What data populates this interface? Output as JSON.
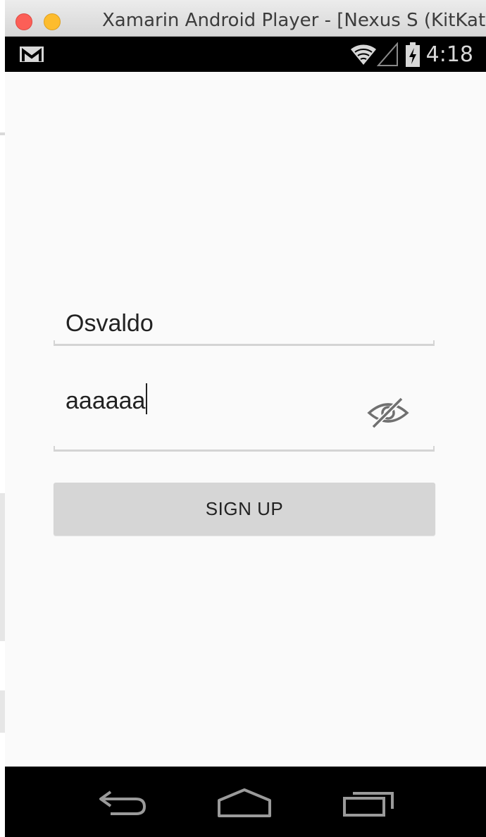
{
  "window": {
    "title": "Xamarin Android Player - [Nexus S (KitKat)]"
  },
  "status_bar": {
    "time": "4:18",
    "icons": [
      "gmail-icon",
      "wifi-icon",
      "signal-icon",
      "battery-charging-icon"
    ]
  },
  "form": {
    "username_value": "Osvaldo",
    "password_value": "aaaaaa",
    "password_visible": true,
    "signup_label": "SIGN UP"
  },
  "nav_bar": {
    "icons": [
      "back-icon",
      "home-icon",
      "recents-icon"
    ]
  },
  "colors": {
    "titlebar": "#dcdcdc",
    "status_bar": "#000000",
    "background": "#fafafa",
    "button": "#d6d6d6",
    "underline": "#d4d4d4",
    "text": "#222222",
    "close": "#fc5f57",
    "minimize": "#fdbc2e"
  }
}
